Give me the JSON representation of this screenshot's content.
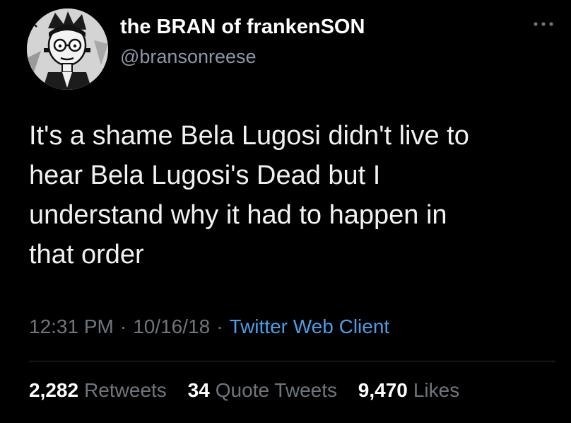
{
  "user": {
    "display_name": "the BRAN of frankenSON",
    "handle": "@bransonreese"
  },
  "tweet": {
    "lines": [
      "It's a shame Bela Lugosi didn't live to",
      "hear Bela Lugosi's Dead but I",
      "understand why it had to happen in",
      "that order"
    ],
    "time": "12:31 PM",
    "date": "10/16/18",
    "separator": "·",
    "source": "Twitter Web Client"
  },
  "stats": {
    "retweets_count": "2,282",
    "retweets_label": "Retweets",
    "quotes_count": "34",
    "quotes_label": "Quote Tweets",
    "likes_count": "9,470",
    "likes_label": "Likes"
  },
  "icons": {
    "avatar": "frankenstein-avatar-icon",
    "more": "more-options-icon"
  },
  "colors": {
    "background": "#000000",
    "text": "#f1f1f1",
    "secondary": "#6e767d",
    "link": "#4a9ee8"
  }
}
